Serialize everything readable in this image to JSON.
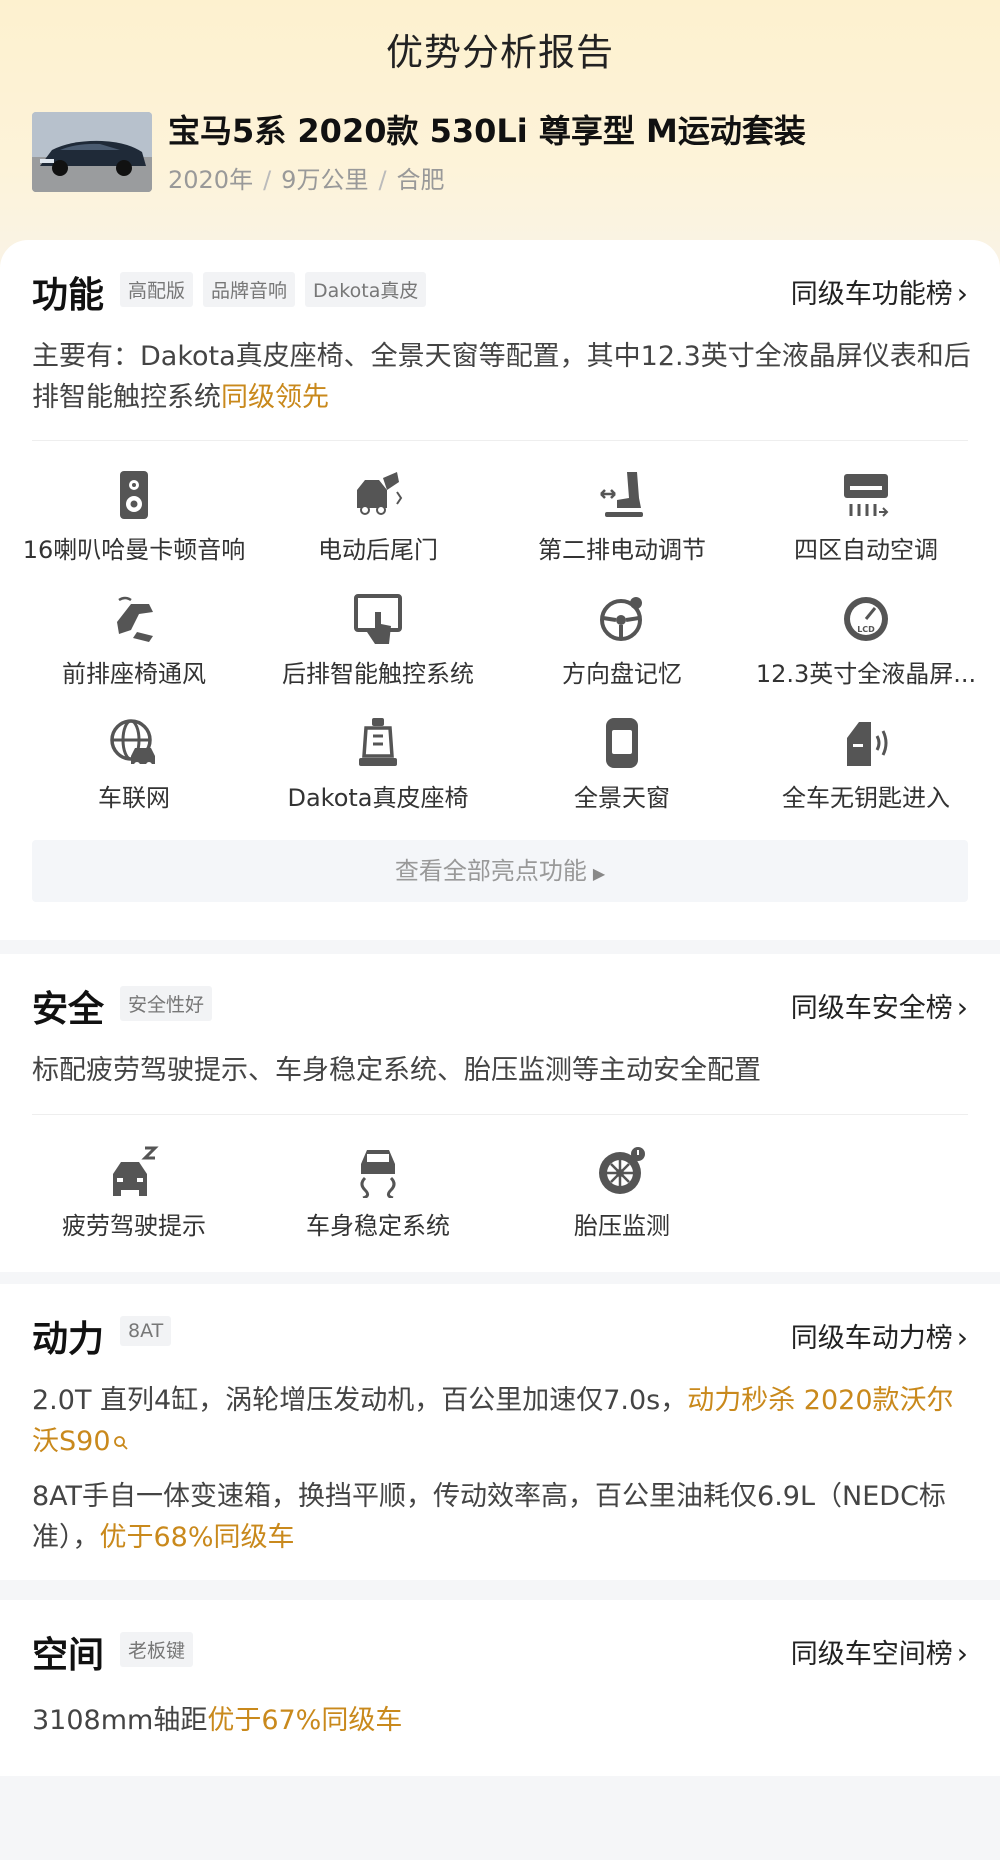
{
  "page": {
    "title": "优势分析报告"
  },
  "car": {
    "name": "宝马5系 2020款 530Li 尊享型 M运动套装",
    "year": "2020年",
    "mileage": "9万公里",
    "city": "合肥"
  },
  "colors": {
    "highlight": "#c9891c",
    "header_bg": "#fdf1cf",
    "icon": "#555555"
  },
  "function": {
    "title": "功能",
    "tags": [
      "高配版",
      "品牌音响",
      "Dakota真皮"
    ],
    "rank_label": "同级车功能榜",
    "desc_prefix": "主要有：Dakota真皮座椅、全景天窗等配置，其中12.3英寸全液晶屏仪表和后排智能触控系统",
    "desc_highlight": "同级领先",
    "features": [
      {
        "icon": "speaker-icon",
        "label": "16喇叭哈曼卡顿音响"
      },
      {
        "icon": "power-tailgate-icon",
        "label": "电动后尾门"
      },
      {
        "icon": "seat-adjust-icon",
        "label": "第二排电动调节"
      },
      {
        "icon": "air-conditioner-icon",
        "label": "四区自动空调"
      },
      {
        "icon": "seat-ventilation-icon",
        "label": "前排座椅通风"
      },
      {
        "icon": "touch-screen-icon",
        "label": "后排智能触控系统"
      },
      {
        "icon": "steering-memory-icon",
        "label": "方向盘记忆"
      },
      {
        "icon": "lcd-gauge-icon",
        "label": "12.3英寸全液晶屏..."
      },
      {
        "icon": "connected-car-icon",
        "label": "车联网"
      },
      {
        "icon": "leather-seat-icon",
        "label": "Dakota真皮座椅"
      },
      {
        "icon": "panoramic-sunroof-icon",
        "label": "全景天窗"
      },
      {
        "icon": "keyless-entry-icon",
        "label": "全车无钥匙进入"
      }
    ],
    "view_all": "查看全部亮点功能"
  },
  "safety": {
    "title": "安全",
    "tags": [
      "安全性好"
    ],
    "rank_label": "同级车安全榜",
    "desc": "标配疲劳驾驶提示、车身稳定系统、胎压监测等主动安全配置",
    "features": [
      {
        "icon": "fatigue-alert-icon",
        "label": "疲劳驾驶提示"
      },
      {
        "icon": "stability-control-icon",
        "label": "车身稳定系统"
      },
      {
        "icon": "tire-pressure-icon",
        "label": "胎压监测"
      }
    ]
  },
  "power": {
    "title": "动力",
    "tags": [
      "8AT"
    ],
    "rank_label": "同级车动力榜",
    "desc1_prefix": "2.0T 直列4缸，涡轮增压发动机，百公里加速仅7.0s，",
    "desc1_highlight": "动力秒杀 2020款沃尔沃S90",
    "desc2_prefix": "8AT手自一体变速箱，换挡平顺，传动效率高，百公里油耗仅6.9L（NEDC标准），",
    "desc2_highlight": "优于68%同级车"
  },
  "space": {
    "title": "空间",
    "tags": [
      "老板键"
    ],
    "rank_label": "同级车空间榜",
    "desc_prefix": "3108mm轴距",
    "desc_highlight": "优于67%同级车"
  }
}
